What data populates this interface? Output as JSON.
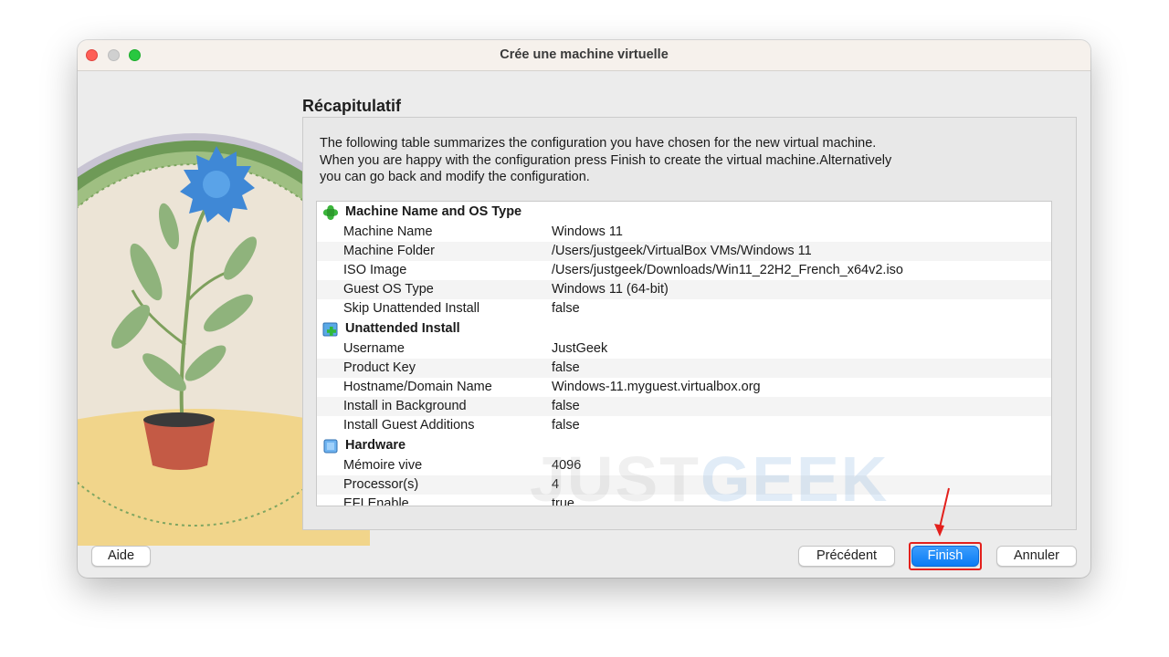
{
  "window": {
    "title": "Crée une machine virtuelle"
  },
  "page": {
    "heading": "Récapitulatif",
    "description_lines": [
      "The following table summarizes the configuration you have chosen for the new virtual machine.",
      "When you are happy with the configuration press Finish to create the virtual machine.Alternatively",
      "you can go back and modify the configuration."
    ]
  },
  "summary": {
    "machine": {
      "title": "Machine Name and OS Type",
      "icon": "green-puzzle-icon",
      "rows": [
        {
          "key": "Machine Name",
          "value": "Windows 11"
        },
        {
          "key": "Machine Folder",
          "value": "/Users/justgeek/VirtualBox VMs/Windows 11"
        },
        {
          "key": "ISO Image",
          "value": "/Users/justgeek/Downloads/Win11_22H2_French_x64v2.iso"
        },
        {
          "key": "Guest OS Type",
          "value": "Windows 11 (64-bit)"
        },
        {
          "key": "Skip Unattended Install",
          "value": "false"
        }
      ]
    },
    "unattended": {
      "title": "Unattended Install",
      "icon": "green-plus-install-icon",
      "rows": [
        {
          "key": "Username",
          "value": "JustGeek"
        },
        {
          "key": "Product Key",
          "value": "false"
        },
        {
          "key": "Hostname/Domain Name",
          "value": "Windows-11.myguest.virtualbox.org"
        },
        {
          "key": "Install in Background",
          "value": "false"
        },
        {
          "key": "Install Guest Additions",
          "value": "false"
        }
      ]
    },
    "hardware": {
      "title": "Hardware",
      "icon": "blue-chip-icon",
      "rows": [
        {
          "key": "Mémoire vive",
          "value": "4096"
        },
        {
          "key": "Processor(s)",
          "value": "4"
        },
        {
          "key": "EFI Enable",
          "value": "true"
        }
      ]
    }
  },
  "buttons": {
    "help": "Aide",
    "back": "Précédent",
    "finish": "Finish",
    "cancel": "Annuler"
  },
  "watermark": {
    "part1": "JUST",
    "part2": "GEEK"
  },
  "colors": {
    "accent_blue": "#0a7cf5",
    "annotation_red": "#e3201c",
    "window_bg": "#ececec"
  }
}
